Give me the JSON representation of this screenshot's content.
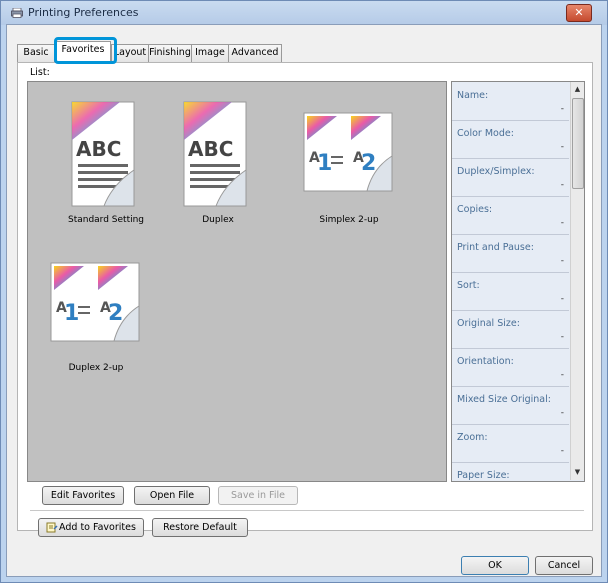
{
  "window": {
    "title": "Printing Preferences",
    "close_glyph": "✕"
  },
  "tabs": [
    {
      "label": "Basic"
    },
    {
      "label": "Favorites"
    },
    {
      "label": "Layout"
    },
    {
      "label": "Finishing"
    },
    {
      "label": "Image"
    },
    {
      "label": "Advanced"
    }
  ],
  "list": {
    "label": "List:",
    "items": [
      {
        "caption": "Standard Setting",
        "icon": "abc-page-icon"
      },
      {
        "caption": "Duplex",
        "icon": "abc-page-icon"
      },
      {
        "caption": "Simplex 2-up",
        "icon": "two-up-icon"
      },
      {
        "caption": "Duplex 2-up",
        "icon": "two-up-icon"
      }
    ]
  },
  "properties": [
    {
      "label": "Name:",
      "value": "-"
    },
    {
      "label": "Color Mode:",
      "value": "-"
    },
    {
      "label": "Duplex/Simplex:",
      "value": "-"
    },
    {
      "label": "Copies:",
      "value": "-"
    },
    {
      "label": "Print and Pause:",
      "value": "-"
    },
    {
      "label": "Sort:",
      "value": "-"
    },
    {
      "label": "Original Size:",
      "value": "-"
    },
    {
      "label": "Orientation:",
      "value": "-"
    },
    {
      "label": "Mixed Size Original:",
      "value": "-"
    },
    {
      "label": "Zoom:",
      "value": "-"
    },
    {
      "label": "Paper Size:",
      "value": "-"
    }
  ],
  "buttons": {
    "edit_favorites": "Edit Favorites",
    "open_file": "Open File",
    "save_in_file": "Save in File",
    "add_to_favorites": "Add to Favorites",
    "restore_default": "Restore Default",
    "ok": "OK",
    "cancel": "Cancel"
  },
  "colors": {
    "highlight": "#0095d9",
    "list_bg": "#c0c0c0",
    "props_bg": "#e6ecf5"
  }
}
